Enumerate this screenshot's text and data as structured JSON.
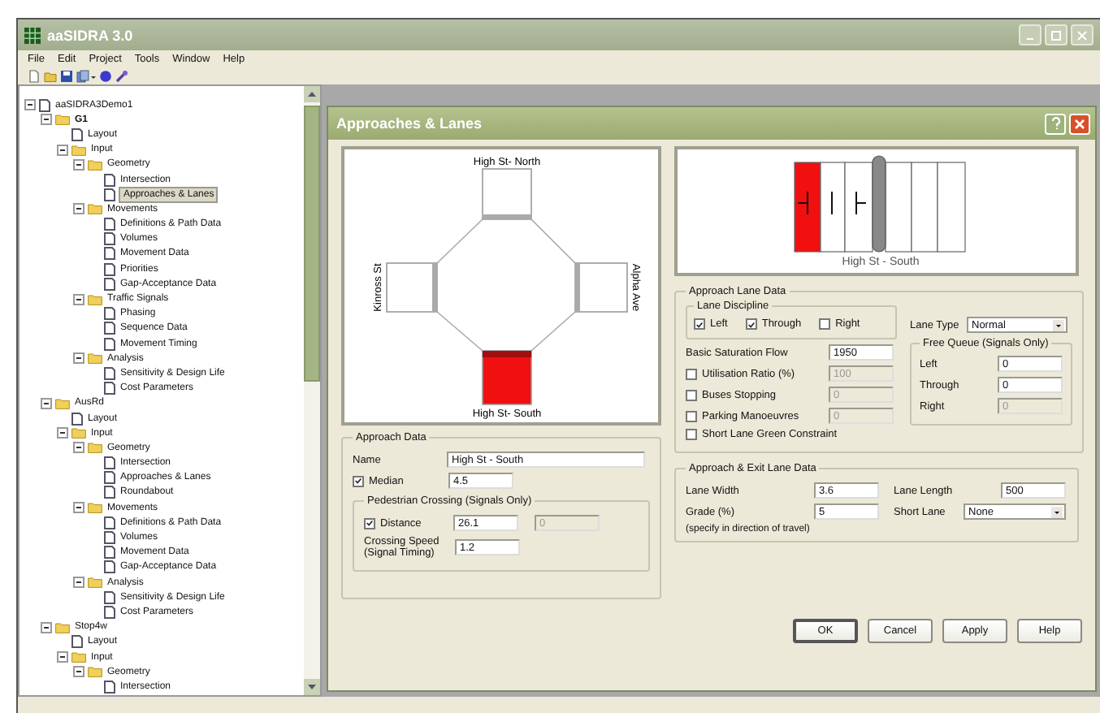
{
  "app": {
    "title": "aaSIDRA 3.0"
  },
  "menu": [
    "File",
    "Edit",
    "Project",
    "Tools",
    "Window",
    "Help"
  ],
  "tree": {
    "root": {
      "label": "aaSIDRA3Demo1",
      "expanded": true,
      "selected": false,
      "children": [
        {
          "label": "G1",
          "expanded": true,
          "selected": false,
          "children": [
            {
              "label": "Layout",
              "selected": false
            },
            {
              "label": "Input",
              "expanded": true,
              "selected": false,
              "children": [
                {
                  "label": "Geometry",
                  "expanded": true,
                  "selected": false,
                  "children": [
                    {
                      "label": "Intersection",
                      "selected": false
                    },
                    {
                      "label": "Approaches & Lanes",
                      "selected": true
                    }
                  ]
                },
                {
                  "label": "Movements",
                  "expanded": true,
                  "selected": false,
                  "children": [
                    {
                      "label": "Definitions & Path Data",
                      "selected": false
                    },
                    {
                      "label": "Volumes",
                      "selected": false
                    },
                    {
                      "label": "Movement Data",
                      "selected": false
                    },
                    {
                      "label": "Priorities",
                      "selected": false
                    },
                    {
                      "label": "Gap-Acceptance Data",
                      "selected": false
                    }
                  ]
                },
                {
                  "label": "Traffic Signals",
                  "expanded": true,
                  "selected": false,
                  "children": [
                    {
                      "label": "Phasing",
                      "selected": false
                    },
                    {
                      "label": "Sequence Data",
                      "selected": false
                    },
                    {
                      "label": "Movement Timing",
                      "selected": false
                    }
                  ]
                },
                {
                  "label": "Analysis",
                  "expanded": true,
                  "selected": false,
                  "children": [
                    {
                      "label": "Sensitivity & Design Life",
                      "selected": false
                    },
                    {
                      "label": "Cost Parameters",
                      "selected": false
                    }
                  ]
                }
              ]
            }
          ]
        },
        {
          "label": "AusRd",
          "expanded": true,
          "selected": false,
          "children": [
            {
              "label": "Layout",
              "selected": false
            },
            {
              "label": "Input",
              "expanded": true,
              "selected": false,
              "children": [
                {
                  "label": "Geometry",
                  "expanded": true,
                  "selected": false,
                  "children": [
                    {
                      "label": "Intersection",
                      "selected": false
                    },
                    {
                      "label": "Approaches & Lanes",
                      "selected": false
                    },
                    {
                      "label": "Roundabout",
                      "selected": false
                    }
                  ]
                },
                {
                  "label": "Movements",
                  "expanded": true,
                  "selected": false,
                  "children": [
                    {
                      "label": "Definitions & Path Data",
                      "selected": false
                    },
                    {
                      "label": "Volumes",
                      "selected": false
                    },
                    {
                      "label": "Movement Data",
                      "selected": false
                    },
                    {
                      "label": "Gap-Acceptance Data",
                      "selected": false
                    }
                  ]
                },
                {
                  "label": "Analysis",
                  "expanded": true,
                  "selected": false,
                  "children": [
                    {
                      "label": "Sensitivity & Design Life",
                      "selected": false
                    },
                    {
                      "label": "Cost Parameters",
                      "selected": false
                    }
                  ]
                }
              ]
            }
          ]
        },
        {
          "label": "Stop4w",
          "expanded": true,
          "selected": false,
          "children": [
            {
              "label": "Layout",
              "selected": false
            },
            {
              "label": "Input",
              "expanded": true,
              "selected": false,
              "children": [
                {
                  "label": "Geometry",
                  "expanded": true,
                  "selected": false,
                  "children": [
                    {
                      "label": "Intersection",
                      "selected": false
                    }
                  ]
                }
              ]
            }
          ]
        }
      ]
    }
  },
  "dialog": {
    "title": "Approaches & Lanes",
    "intersection": {
      "approaches": [
        {
          "label": "High St- North",
          "selected": false
        },
        {
          "label": "Kinross St",
          "selected": false
        },
        {
          "label": "Alpha Ave",
          "selected": false
        },
        {
          "label": "High St- South",
          "selected": true
        }
      ]
    },
    "lane_preview": {
      "label": "High St - South"
    },
    "approach_data": {
      "title": "Approach Data",
      "name": {
        "label": "Name",
        "value": "High St - South"
      },
      "median": {
        "label": "Median",
        "checked": true,
        "value": "4.5"
      },
      "pedestrian": {
        "title": "Pedestrian Crossing (Signals Only)",
        "distance": {
          "label": "Distance",
          "checked": true,
          "value": "26.1",
          "value_2": "0"
        },
        "speed": {
          "label": "Crossing Speed (Signal Timing)",
          "value": "1.2"
        }
      }
    },
    "lane_data": {
      "title": "Approach Lane Data",
      "discipline": {
        "title": "Lane Discipline",
        "options": [
          {
            "label": "Left",
            "checked": true
          },
          {
            "label": "Through",
            "checked": true
          },
          {
            "label": "Right",
            "checked": false
          }
        ]
      },
      "lane_type": {
        "label": "Lane Type",
        "value": "Normal"
      },
      "saturation": {
        "label": "Basic Saturation Flow",
        "value": "1950"
      },
      "checks": [
        {
          "label": "Utilisation Ratio (%)",
          "checked": false,
          "value": "100",
          "disabled": true
        },
        {
          "label": "Buses Stopping",
          "checked": false,
          "value": "0",
          "disabled": true
        },
        {
          "label": "Parking Manoeuvres",
          "checked": false,
          "value": "0",
          "disabled": true
        },
        {
          "label": "Short Lane Green Constraint",
          "checked": false
        }
      ],
      "free_queue": {
        "title": "Free Queue (Signals Only)",
        "rows": [
          {
            "label": "Left",
            "value": "0",
            "disabled": false
          },
          {
            "label": "Through",
            "value": "0",
            "disabled": false
          },
          {
            "label": "Right",
            "value": "0",
            "disabled": true
          }
        ]
      }
    },
    "exit_data": {
      "title": "Approach & Exit Lane Data",
      "lane_width": {
        "label": "Lane Width",
        "value": "3.6"
      },
      "lane_length": {
        "label": "Lane Length",
        "value": "500"
      },
      "grade": {
        "label": "Grade (%)",
        "value": "5",
        "note": "(specify in direction of travel)"
      },
      "short_lane": {
        "label": "Short Lane",
        "value": "None"
      }
    },
    "buttons": [
      {
        "label": "OK",
        "default": true
      },
      {
        "label": "Cancel",
        "default": false
      },
      {
        "label": "Apply",
        "default": false
      },
      {
        "label": "Help",
        "default": false
      }
    ]
  }
}
